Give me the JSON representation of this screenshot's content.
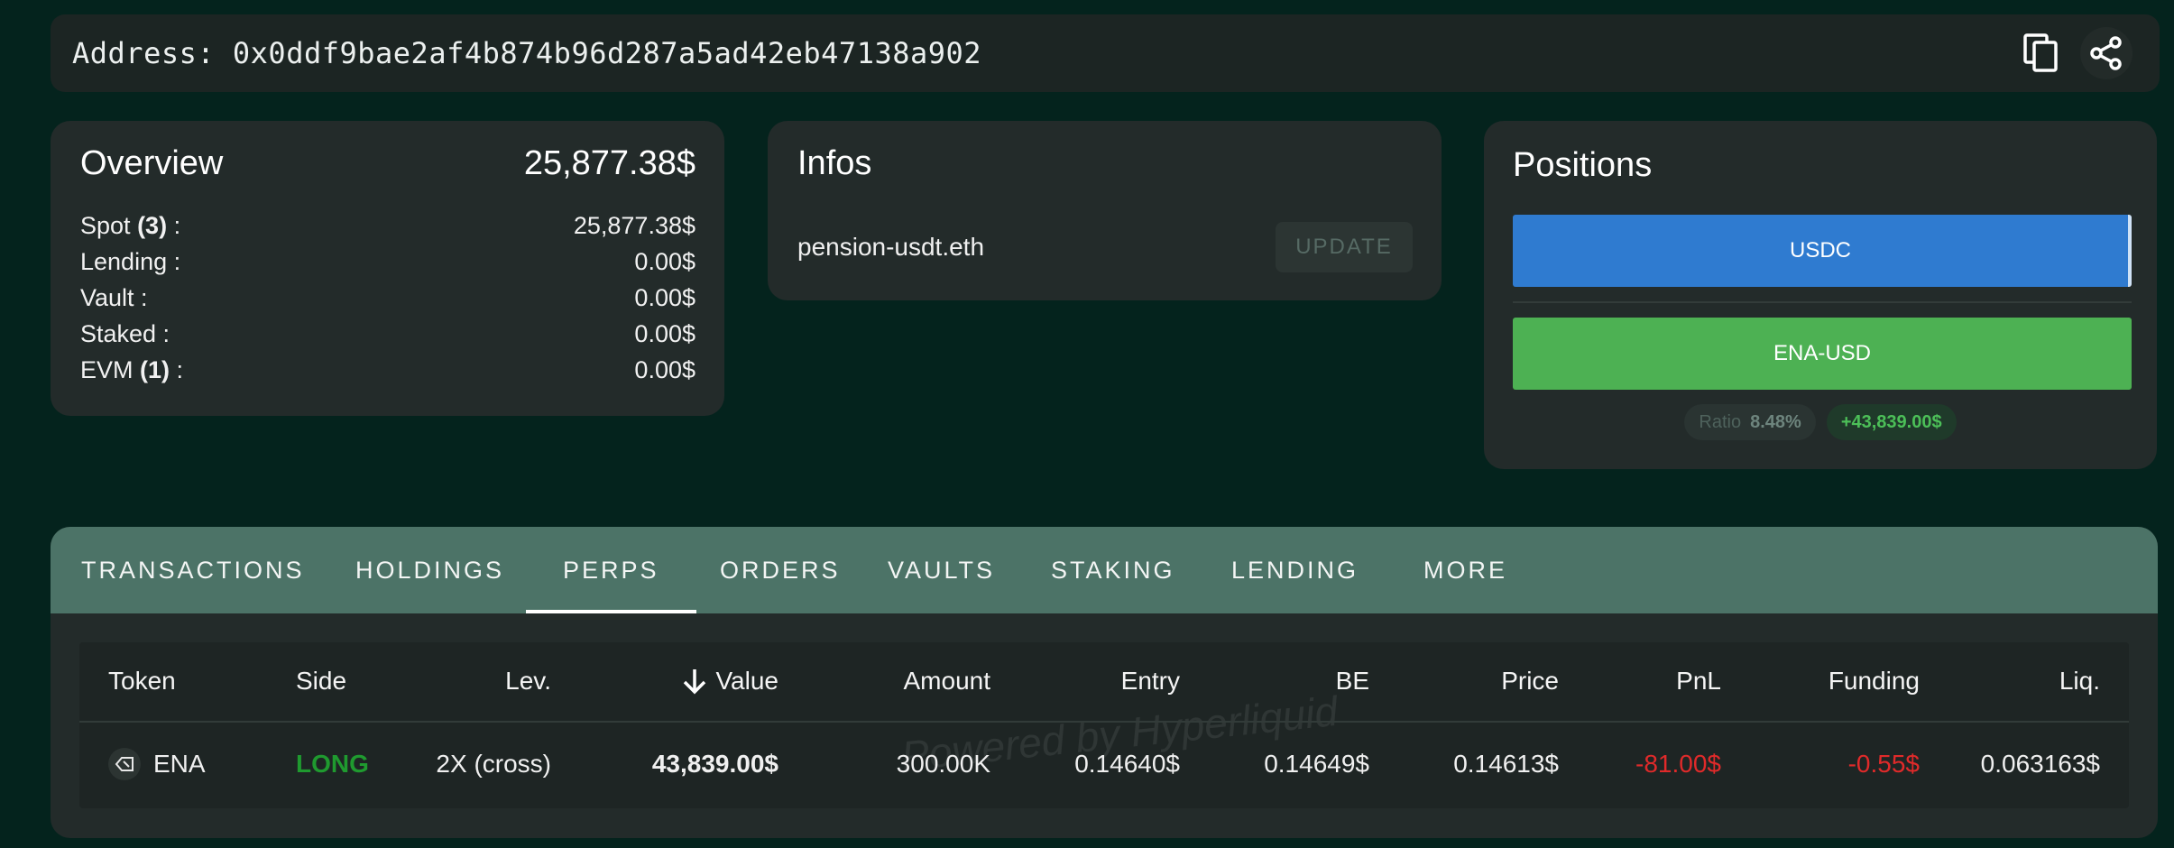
{
  "address_bar": {
    "label": "Address: 0x0ddf9bae2af4b874b96d287a5ad42eb47138a902",
    "copy_icon": "copy-icon",
    "share_icon": "share-icon"
  },
  "overview": {
    "title": "Overview",
    "total": "25,877.38$",
    "rows": [
      {
        "label": "Spot",
        "count": "(3)",
        "suffix": " :",
        "value": "25,877.38$"
      },
      {
        "label": "Lending :",
        "count": "",
        "suffix": "",
        "value": "0.00$"
      },
      {
        "label": "Vault :",
        "count": "",
        "suffix": "",
        "value": "0.00$"
      },
      {
        "label": "Staked :",
        "count": "",
        "suffix": "",
        "value": "0.00$"
      },
      {
        "label": "EVM",
        "count": "(1)",
        "suffix": " :",
        "value": "0.00$"
      }
    ]
  },
  "infos": {
    "title": "Infos",
    "name": "pension-usdt.eth",
    "update_label": "UPDATE"
  },
  "positions": {
    "title": "Positions",
    "usdc_label": "USDC",
    "ena_label": "ENA-USD",
    "ratio_label": "Ratio",
    "ratio_value": "8.48%",
    "pnl_value": "+43,839.00$"
  },
  "tabs": [
    {
      "label": "TRANSACTIONS",
      "active": false
    },
    {
      "label": "HOLDINGS",
      "active": false
    },
    {
      "label": "PERPS",
      "active": true
    },
    {
      "label": "ORDERS",
      "active": false
    },
    {
      "label": "VAULTS",
      "active": false
    },
    {
      "label": "STAKING",
      "active": false
    },
    {
      "label": "LENDING",
      "active": false
    },
    {
      "label": "MORE",
      "active": false
    }
  ],
  "table": {
    "headers": {
      "token": "Token",
      "side": "Side",
      "lev": "Lev.",
      "value": "Value",
      "amount": "Amount",
      "entry": "Entry",
      "be": "BE",
      "price": "Price",
      "pnl": "PnL",
      "funding": "Funding",
      "liq": "Liq."
    },
    "sort_icon": "arrow-down-icon",
    "watermark": "Powered by Hyperliquid",
    "rows": [
      {
        "token": "ENA",
        "side": "LONG",
        "lev": "2X (cross)",
        "value": "43,839.00$",
        "amount": "300.00K",
        "entry": "0.14640$",
        "be": "0.14649$",
        "price": "0.14613$",
        "pnl": "-81.00$",
        "funding": "-0.55$",
        "liq": "0.063163$"
      }
    ]
  },
  "colors": {
    "background": "#04231d",
    "card": "#232b2a",
    "tab_strip": "#4c7367",
    "usdc": "#2f7bd0",
    "ena": "#4db153",
    "long": "#1f9a2f",
    "negative": "#e02a2a"
  }
}
